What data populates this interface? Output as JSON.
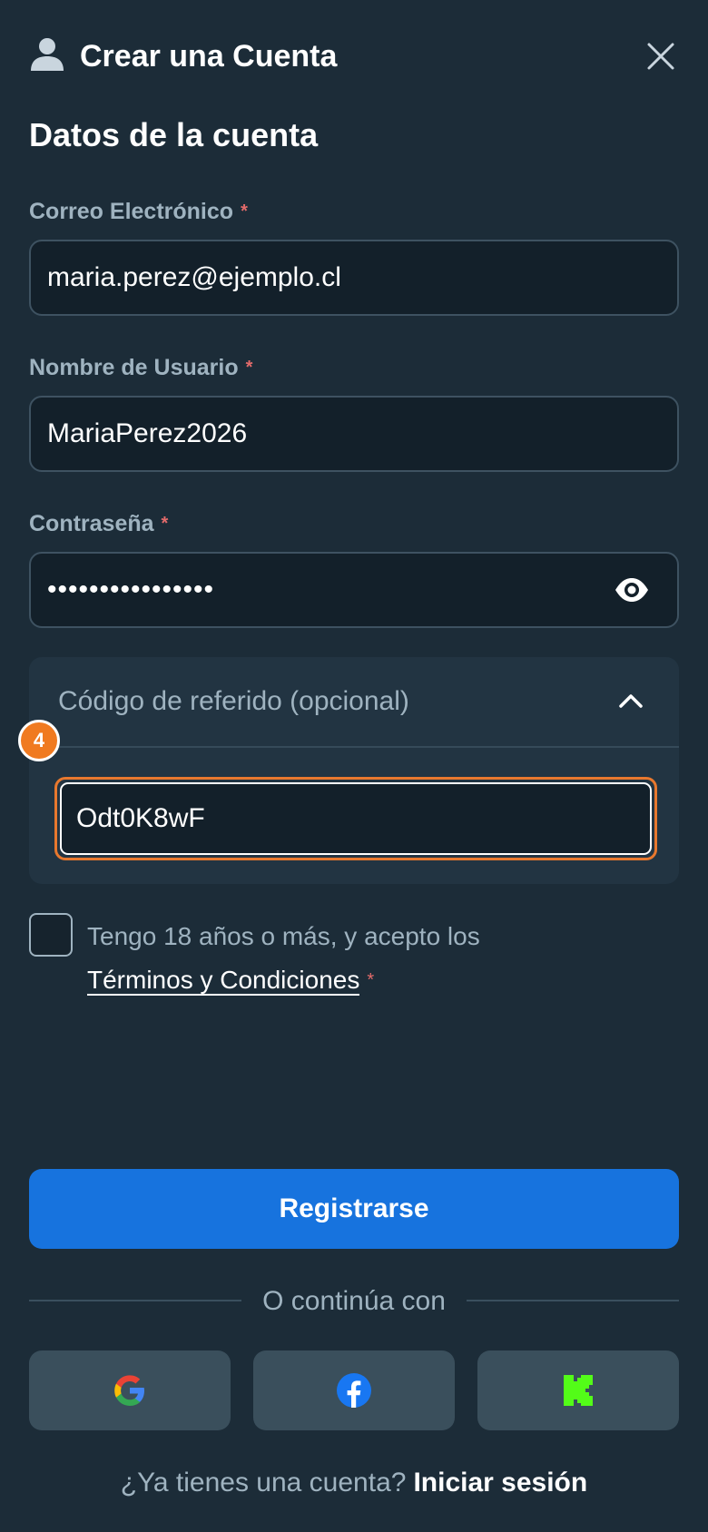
{
  "header": {
    "title": "Crear una Cuenta",
    "user_icon": "user-icon",
    "close_icon": "close-icon"
  },
  "section_title": "Datos de la cuenta",
  "fields": {
    "email": {
      "label": "Correo Electrónico",
      "value": "maria.perez@ejemplo.cl",
      "required_mark": "*"
    },
    "username": {
      "label": "Nombre de Usuario",
      "value": "MariaPerez2026",
      "required_mark": "*"
    },
    "password": {
      "label": "Contraseña",
      "value": "••••••••••••••••",
      "required_mark": "*",
      "eye_icon": "eye-icon"
    }
  },
  "referral": {
    "header": "Código de referido (opcional)",
    "value": "Odt0K8wF",
    "expanded": true,
    "badge": "4",
    "chevron_icon": "chevron-up-icon"
  },
  "terms": {
    "line1": "Tengo 18 años o más, y acepto los",
    "link": "Términos y Condiciones",
    "required_mark": "*",
    "checked": false
  },
  "register_button": "Registrarse",
  "divider_text": "O continúa con",
  "social": [
    "google-icon",
    "facebook-icon",
    "kick-icon"
  ],
  "footer": {
    "question": "¿Ya tienes una cuenta?",
    "link": "Iniciar sesión"
  },
  "colors": {
    "background": "#1c2c38",
    "primary": "#1773de",
    "focus": "#e8782e",
    "required": "#e36b6b"
  }
}
